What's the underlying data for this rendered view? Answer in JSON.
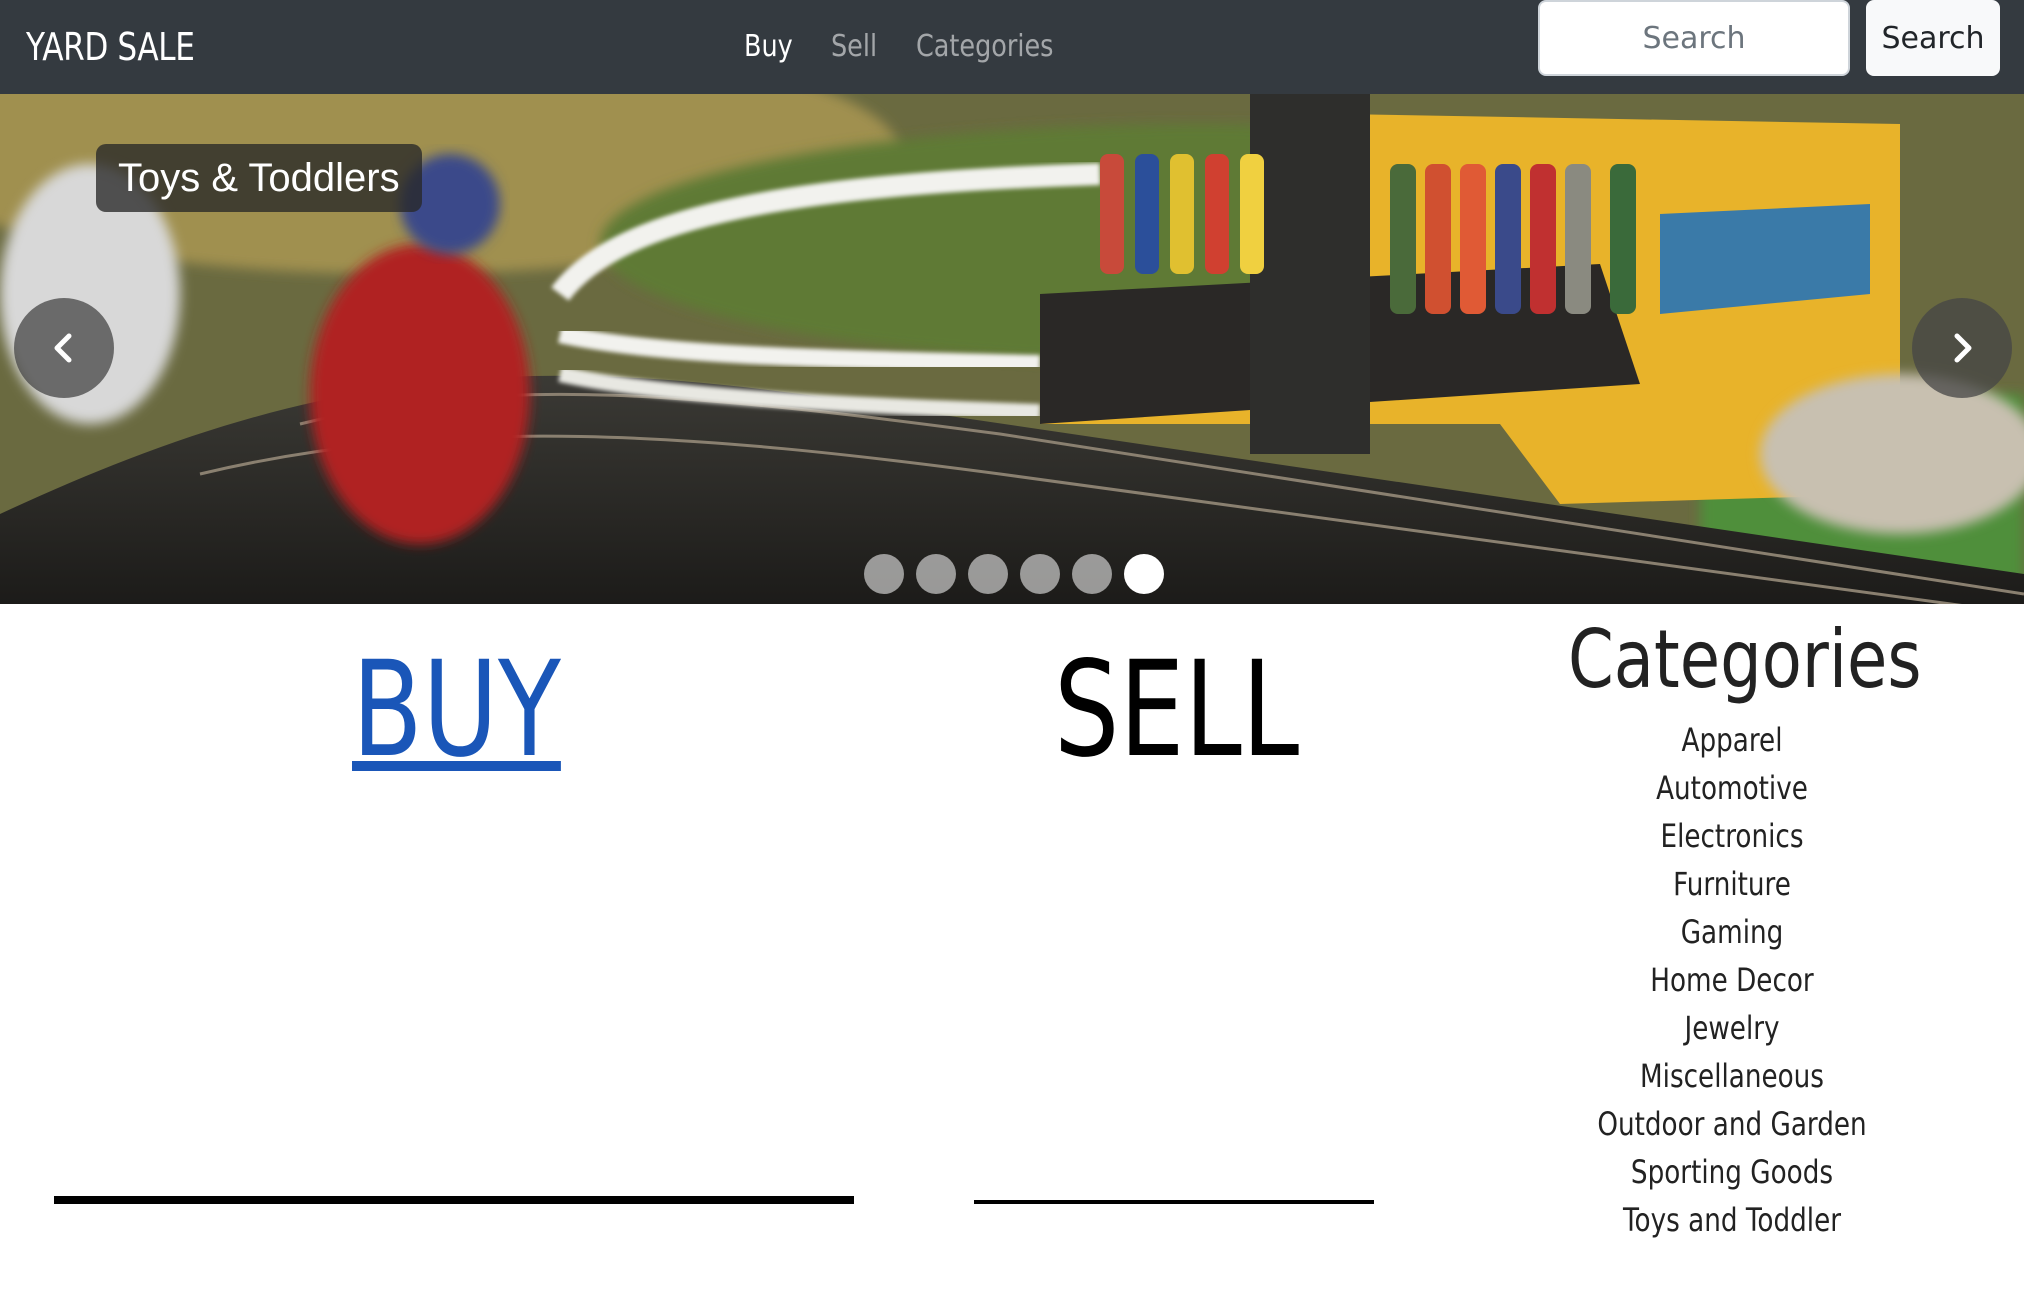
{
  "navbar": {
    "brand": "YARD SALE",
    "links": [
      {
        "label": "Buy",
        "active": true
      },
      {
        "label": "Sell",
        "active": false
      },
      {
        "label": "Categories",
        "active": false
      }
    ],
    "search_placeholder": "Search",
    "search_button": "Search",
    "background_color": "#343a40"
  },
  "carousel": {
    "caption": "Toys & Toddlers",
    "slide_count": 6,
    "active_slide": 6,
    "prev_icon": "chevron-left-icon",
    "next_icon": "chevron-right-icon"
  },
  "buy": {
    "heading": "BUY",
    "link_color": "#1a56b8"
  },
  "sell": {
    "heading": "SELL"
  },
  "categories": {
    "heading": "Categories",
    "items": [
      "Apparel",
      "Automotive",
      "Electronics",
      "Furniture",
      "Gaming",
      "Home Decor",
      "Jewelry",
      "Miscellaneous",
      "Outdoor and Garden",
      "Sporting Goods",
      "Toys and Toddler"
    ]
  }
}
